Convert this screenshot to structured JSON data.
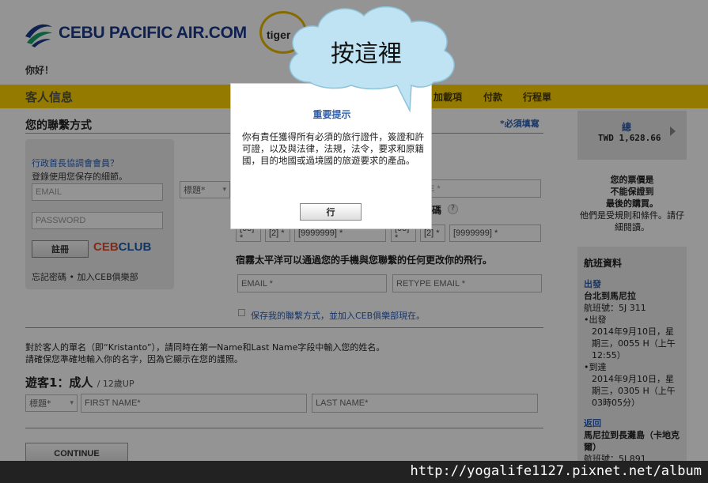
{
  "header": {
    "logo_text": "CEBU PACIFIC AIR.COM",
    "partner_logo": "tiger",
    "greeting": "你好！"
  },
  "nav": {
    "section_title": "客人信息",
    "items": [
      "加載項",
      "付款",
      "行程單"
    ]
  },
  "contact": {
    "title": "您的聯繫方式",
    "required_note": "*必須填寫",
    "login": {
      "title": "行政首長協調會會員？",
      "subtitle": "登錄使用您保存的細節。",
      "email_placeholder": "EMAIL",
      "password_placeholder": "PASSWORD",
      "register_button": "註冊",
      "club_logo_a": "CEB",
      "club_logo_b": "CLUB",
      "links": "忘記密碼 • 加入CEB俱樂部"
    },
    "title_select": "標題*",
    "name_placeholder": "ME *",
    "phone_label": "碼",
    "phone_help": "?",
    "phone_fields": [
      "[63] *",
      "[2] *",
      "[9999999] *",
      "[63] *",
      "[2] *",
      "[9999999] *"
    ],
    "notice": "宿霧太平洋可以通過您的手機與您聯繫的任何更改你的飛行。",
    "email_placeholder": "EMAIL *",
    "retype_email_placeholder": "RETYPE EMAIL *",
    "save_label": "保存我的聯繫方式，並加入CEB俱樂部現在。"
  },
  "passenger": {
    "instruction_line1": "對於客人的單名（即“Kristanto”），請同時在第一Name和Last Name字段中輸入您的姓名。",
    "instruction_line2": "請確保您準確地輸入你的名字，因為它顯示在您的護照。",
    "title": "遊客1：成人",
    "age_note": "/ 12歲UP",
    "title_select": "標題*",
    "first_name_placeholder": "FIRST NAME*",
    "last_name_placeholder": "LAST NAME*",
    "continue_button": "CONTINUE"
  },
  "sidebar": {
    "total_label": "總",
    "total_value": "TWD 1,628.66",
    "price_note_bold": "您的票價是\n不能保證到\n最後的購買。",
    "price_note_rest": "他們是受規則和條件。請仔細閱讀。",
    "flight_title": "航班資料",
    "departure_label": "出發",
    "departure_route": "台北到馬尼拉",
    "departure_flight": "航班號：5J 311",
    "depart_tag": "•出發",
    "depart_time": "2014年9月10日，星期三，0055 H（上午12:55）",
    "arrive_tag": "•到達",
    "arrive_time": "2014年9月10日，星期三，0305 H（上午03時05分）",
    "return_label": "返回",
    "return_route": "馬尼拉到長灘島（卡地克爾）",
    "return_flight": "航班號：5J 891"
  },
  "modal": {
    "title": "重要提示",
    "body": "你有責任獲得所有必須的旅行證件，簽證和許可證，以及與法律，法規，法令，要求和原籍國，目的地國或過境國的旅遊要求的產品。",
    "ok_button": "行"
  },
  "callout": {
    "text": "按這裡"
  },
  "watermark": {
    "text": "http://yogalife1127.pixnet.net/album"
  }
}
